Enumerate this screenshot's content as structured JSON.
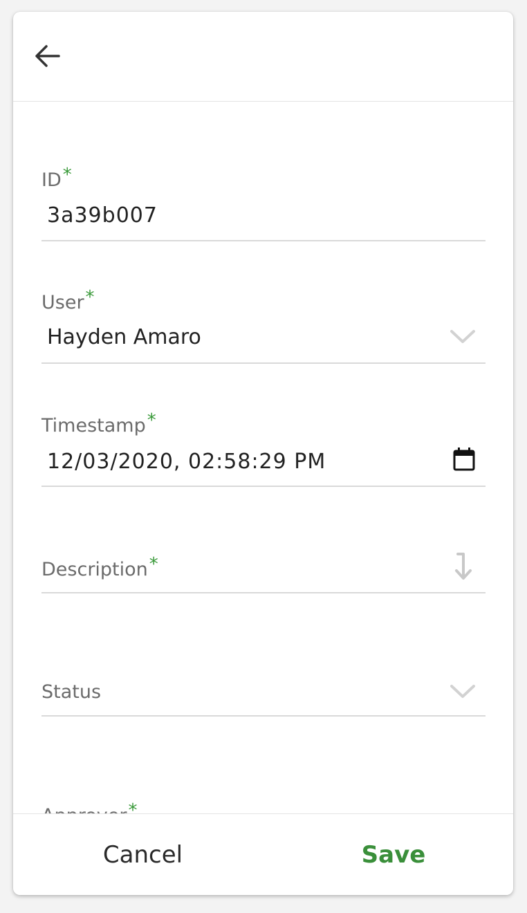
{
  "header": {
    "back_icon": "arrow-left-icon"
  },
  "form": {
    "id": {
      "label": "ID",
      "required_mark": "*",
      "value": "3a39b007"
    },
    "user": {
      "label": "User",
      "required_mark": "*",
      "value": "Hayden Amaro",
      "icon": "chevron-down-icon"
    },
    "timestamp": {
      "label": "Timestamp",
      "required_mark": "*",
      "value": "12/03/2020, 02:58:29 PM",
      "icon": "calendar-icon"
    },
    "description": {
      "label": "Description",
      "required_mark": "*",
      "value": "",
      "icon": "expand-down-arrow-icon"
    },
    "status": {
      "label": "Status",
      "value": "",
      "icon": "chevron-down-icon"
    },
    "approver": {
      "label": "Approver",
      "required_mark": "*"
    }
  },
  "footer": {
    "cancel_label": "Cancel",
    "save_label": "Save"
  },
  "colors": {
    "accent": "#3a8f3a",
    "required": "#3a9a3a",
    "label": "#6b6b6b",
    "divider": "#d9d9d9"
  }
}
